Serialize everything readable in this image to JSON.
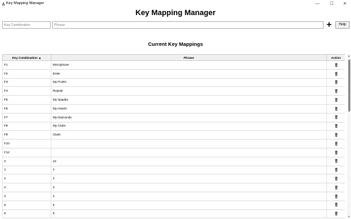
{
  "window": {
    "title": "Key Mapping Manager",
    "minimize_glyph": "—",
    "maximize_glyph": "☐",
    "close_glyph": "✕"
  },
  "app": {
    "heading": "Key Mapping Manager"
  },
  "inputs": {
    "key_placeholder": "Key Combination",
    "key_value": "",
    "phrase_placeholder": "Phrase",
    "phrase_value": "",
    "add_label": "+",
    "help_label": "Help"
  },
  "mappings": {
    "section_title": "Current Key Mappings",
    "columns": {
      "key": "Key Combination ▲",
      "phrase": "Phrase",
      "action": "Action"
    },
    "rows": [
      {
        "key": "F1",
        "phrase": "Microphone"
      },
      {
        "key": "F2",
        "phrase": "Enter"
      },
      {
        "key": "F3",
        "phrase": "My Points"
      },
      {
        "key": "F4",
        "phrase": "Repeat"
      },
      {
        "key": "F5",
        "phrase": "My Spades"
      },
      {
        "key": "F6",
        "phrase": "My Hearts"
      },
      {
        "key": "F7",
        "phrase": "My Diamonds"
      },
      {
        "key": "F8",
        "phrase": "My Clubs"
      },
      {
        "key": "F9",
        "phrase": "Claim"
      },
      {
        "key": "F10",
        "phrase": ""
      },
      {
        "key": "F12",
        "phrase": ""
      },
      {
        "key": "0",
        "phrase": "10"
      },
      {
        "key": "1",
        "phrase": "1"
      },
      {
        "key": "2",
        "phrase": "2"
      },
      {
        "key": "3",
        "phrase": "3"
      },
      {
        "key": "4",
        "phrase": "4"
      },
      {
        "key": "5",
        "phrase": "5"
      },
      {
        "key": "6",
        "phrase": "6"
      }
    ]
  },
  "icons": {
    "delete": "trash-icon",
    "app": "app-icon"
  },
  "colors": {
    "header_bg": "#f0f0f0",
    "scroll_thumb": "#8b8b8b",
    "border": "#b9b9b9"
  }
}
